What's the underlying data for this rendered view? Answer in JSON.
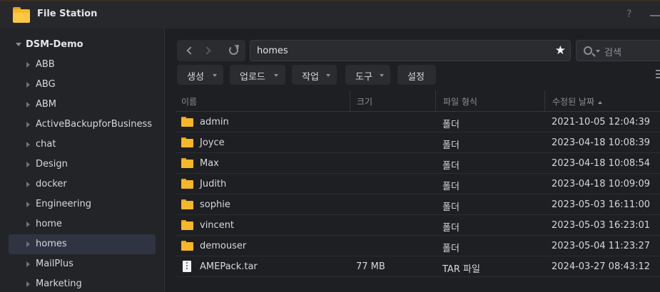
{
  "window": {
    "title": "File Station",
    "help_glyph": "?"
  },
  "sidebar": {
    "root_label": "DSM-Demo",
    "items": [
      {
        "label": "ABB"
      },
      {
        "label": "ABG"
      },
      {
        "label": "ABM"
      },
      {
        "label": "ActiveBackupforBusiness"
      },
      {
        "label": "chat"
      },
      {
        "label": "Design"
      },
      {
        "label": "docker"
      },
      {
        "label": "Engineering"
      },
      {
        "label": "home"
      },
      {
        "label": "homes",
        "selected": true
      },
      {
        "label": "MailPlus"
      },
      {
        "label": "Marketing"
      }
    ]
  },
  "navigation": {
    "path": "homes",
    "favorite_glyph": "★"
  },
  "search": {
    "placeholder": "검색"
  },
  "toolbar": {
    "create": "생성",
    "upload": "업로드",
    "action": "작업",
    "tools": "도구",
    "settings": "설정"
  },
  "table": {
    "headers": {
      "name": "이름",
      "size": "크기",
      "type": "파일 형식",
      "modified": "수정된 날짜"
    },
    "rows": [
      {
        "name": "admin",
        "size": "",
        "type": "폴더",
        "modified": "2021-10-05 12:04:39",
        "icon": "folder-icon"
      },
      {
        "name": "Joyce",
        "size": "",
        "type": "폴더",
        "modified": "2023-04-18 10:08:39",
        "icon": "folder-icon"
      },
      {
        "name": "Max",
        "size": "",
        "type": "폴더",
        "modified": "2023-04-18 10:08:54",
        "icon": "folder-icon"
      },
      {
        "name": "Judith",
        "size": "",
        "type": "폴더",
        "modified": "2023-04-18 10:09:09",
        "icon": "folder-icon"
      },
      {
        "name": "sophie",
        "size": "",
        "type": "폴더",
        "modified": "2023-05-03 16:11:00",
        "icon": "folder-icon"
      },
      {
        "name": "vincent",
        "size": "",
        "type": "폴더",
        "modified": "2023-05-03 16:23:01",
        "icon": "folder-icon"
      },
      {
        "name": "demouser",
        "size": "",
        "type": "폴더",
        "modified": "2023-05-04 11:23:27",
        "icon": "folder-icon"
      },
      {
        "name": "AMEPack.tar",
        "size": "77 MB",
        "type": "TAR 파일",
        "modified": "2024-03-27 08:43:12",
        "icon": "archive-file-icon"
      }
    ]
  },
  "colors": {
    "accent_folder": "#f6b728",
    "selected_bg": "#2e3442",
    "window_bg": "#1e1f22"
  }
}
